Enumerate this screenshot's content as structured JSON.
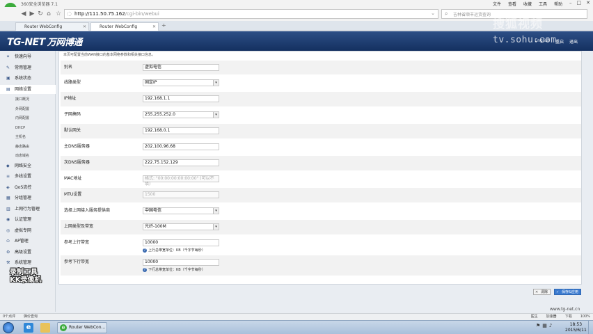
{
  "browser": {
    "title": "360安全浏览器 7.1",
    "menus": [
      "文件",
      "查看",
      "收藏",
      "工具",
      "帮助"
    ],
    "url_host": "http://111.50.75.162",
    "url_path": "/cgi-bin/webui",
    "search_placeholder": "吉林省顺丰运货查询",
    "tabs": [
      {
        "label": "Router WebConfig",
        "active": false
      },
      {
        "label": "Router WebConfig",
        "active": true
      }
    ]
  },
  "header": {
    "brand_latin": "TG-NET",
    "brand_cn": "万网博通",
    "links": [
      "English",
      "重启",
      "退出"
    ],
    "watermark": "搜狐视频",
    "watermark_url": "tv.sohu.com"
  },
  "sidebar": {
    "items": [
      {
        "label": "快速向导",
        "icon": "wand-icon",
        "sub": false
      },
      {
        "label": "常用管理",
        "icon": "wrench-icon",
        "sub": false
      },
      {
        "label": "系统状态",
        "icon": "monitor-icon",
        "sub": false
      },
      {
        "label": "网络设置",
        "icon": "network-icon",
        "sub": false,
        "selected": true
      },
      {
        "label": "接口概况",
        "sub": true
      },
      {
        "label": "外网配置",
        "sub": true
      },
      {
        "label": "内网配置",
        "sub": true
      },
      {
        "label": "DHCP",
        "sub": true
      },
      {
        "label": "主机名",
        "sub": true
      },
      {
        "label": "静态路由",
        "sub": true
      },
      {
        "label": "动态域名",
        "sub": true
      },
      {
        "label": "网络安全",
        "icon": "shield-icon",
        "sub": false
      },
      {
        "label": "多线设置",
        "icon": "lines-icon",
        "sub": false
      },
      {
        "label": "QoS流控",
        "icon": "qos-icon",
        "sub": false
      },
      {
        "label": "分组管理",
        "icon": "group-icon",
        "sub": false
      },
      {
        "label": "上网行为管理",
        "icon": "behavior-icon",
        "sub": false
      },
      {
        "label": "认证管理",
        "icon": "auth-icon",
        "sub": false
      },
      {
        "label": "虚拟专网",
        "icon": "vpn-icon",
        "sub": false
      },
      {
        "label": "AP管理",
        "icon": "ap-icon",
        "sub": false
      },
      {
        "label": "高级设置",
        "icon": "advanced-icon",
        "sub": false
      },
      {
        "label": "系统管理",
        "icon": "system-icon",
        "sub": false
      }
    ]
  },
  "form": {
    "intro": "本页可配置当前WAN接口的基本网络参数和相关接口信息。",
    "rows": [
      {
        "label": "别名",
        "type": "text",
        "value": "虚拟电信"
      },
      {
        "label": "线路类型",
        "type": "select",
        "value": "固定IP"
      },
      {
        "label": "IP地址",
        "type": "text",
        "value": "192.168.1.1"
      },
      {
        "label": "子网掩码",
        "type": "select",
        "value": "255.255.252.0"
      },
      {
        "label": "默认网关",
        "type": "text",
        "value": "192.168.0.1"
      },
      {
        "label": "主DNS服务器",
        "type": "text",
        "value": "202.100.96.68"
      },
      {
        "label": "次DNS服务器",
        "type": "text",
        "value": "222.75.152.129"
      },
      {
        "label": "MAC地址",
        "type": "text",
        "value": "",
        "placeholder": "格式: \"00:00:00:00:00:00\" (可以不填)",
        "disabled": true
      },
      {
        "label": "MTU设置",
        "type": "text",
        "value": "1500",
        "disabled": true
      },
      {
        "label": "选择上网接入服务提供商",
        "type": "select",
        "value": "中国电信"
      },
      {
        "label": "上网类型及带宽",
        "type": "select",
        "value": "光纤-100M"
      },
      {
        "label": "参考上行带宽",
        "type": "text",
        "value": "10000",
        "hint": "上行总带宽单位：KB（千字节每秒）"
      },
      {
        "label": "参考下行带宽",
        "type": "text",
        "value": "10000",
        "hint": "下行总带宽单位：KB（千字节每秒）"
      }
    ],
    "buttons": {
      "clear": "清除",
      "save": "保存&应用"
    }
  },
  "overlay_text": {
    "line1": "录制工具",
    "line2": "KK录像机"
  },
  "footer_url": "www.tg-net.cn",
  "statusbar": {
    "left1": "0个点评",
    "left2": "弹价查询",
    "right": [
      "医生",
      "加速器",
      "下载",
      "100%"
    ]
  },
  "taskbar": {
    "browser_label": "Router WebCon...",
    "time": "18:53",
    "date": "2015/6/11"
  }
}
